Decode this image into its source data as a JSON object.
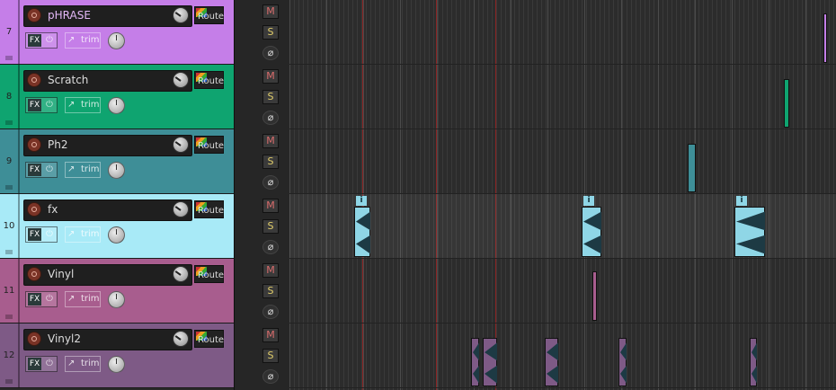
{
  "tracks": [
    {
      "number": "7",
      "name": "pHRASE",
      "color": "#c57ee8",
      "nameColor": "#e3b8f7",
      "fx_label": "FX",
      "trim_label": "trim",
      "route_label": "Route"
    },
    {
      "number": "8",
      "name": "Scratch",
      "color": "#0fa470",
      "nameColor": "#dddddd",
      "fx_label": "FX",
      "trim_label": "trim",
      "route_label": "Route"
    },
    {
      "number": "9",
      "name": "Ph2",
      "color": "#3e8e97",
      "nameColor": "#dddddd",
      "fx_label": "FX",
      "trim_label": "trim",
      "route_label": "Route"
    },
    {
      "number": "10",
      "name": "fx",
      "color": "#a8eaf7",
      "nameColor": "#dddddd",
      "fx_label": "FX",
      "trim_label": "trim",
      "route_label": "Route"
    },
    {
      "number": "11",
      "name": "Vinyl",
      "color": "#a85d8e",
      "nameColor": "#dddddd",
      "fx_label": "FX",
      "trim_label": "trim",
      "route_label": "Route"
    },
    {
      "number": "12",
      "name": "Vinyl2",
      "color": "#7e5a86",
      "nameColor": "#dddddd",
      "fx_label": "FX",
      "trim_label": "trim",
      "route_label": "Route"
    }
  ],
  "mixer": {
    "mute_label": "M",
    "solo_label": "S",
    "phase_label": "⌀"
  },
  "item_badge": "i",
  "colors": {
    "selected_lane": "#a8eaf7",
    "marker": "#8a2424"
  }
}
